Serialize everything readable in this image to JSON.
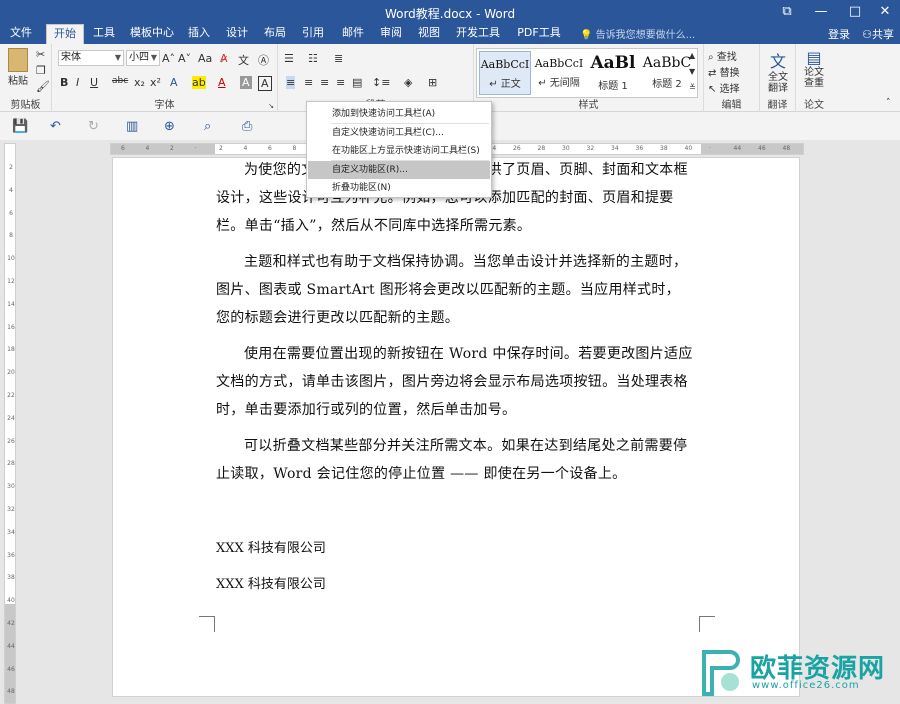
{
  "window": {
    "title": "Word教程.docx - Word",
    "restore_icon": "restore-icon",
    "minimize_label": "—",
    "maximize_label": "□",
    "close_label": "✕"
  },
  "tabs": [
    "文件",
    "开始",
    "工具",
    "模板中心",
    "插入",
    "设计",
    "布局",
    "引用",
    "邮件",
    "审阅",
    "视图",
    "开发工具",
    "PDF工具集"
  ],
  "active_tab": "开始",
  "tell_me": "告诉我您想要做什么...",
  "login": "登录",
  "share": "共享",
  "ribbon": {
    "clipboard": {
      "paste": "粘贴",
      "label": "剪贴板"
    },
    "font": {
      "name": "宋体",
      "size": "小四",
      "label": "字体"
    },
    "paragraph": {
      "label": "段落"
    },
    "styles": {
      "label": "样式",
      "items": [
        {
          "sample": "AaBbCcI",
          "name": "↵ 正文"
        },
        {
          "sample": "AaBbCcI",
          "name": "↵ 无间隔"
        },
        {
          "sample": "AaBl",
          "name": "标题 1"
        },
        {
          "sample": "AaBbC",
          "name": "标题 2"
        }
      ]
    },
    "editing": {
      "find": "查找",
      "replace": "替换",
      "select": "选择",
      "label": "编辑"
    },
    "translate": {
      "text": "全文翻译",
      "label": "翻译"
    },
    "paper": {
      "text": "论文查重",
      "label": "论文"
    }
  },
  "context_menu": {
    "items": [
      "添加到快速访问工具栏(A)",
      "自定义快速访问工具栏(C)...",
      "在功能区上方显示快速访问工具栏(S)",
      "自定义功能区(R)...",
      "折叠功能区(N)"
    ],
    "highlighted_index": 3
  },
  "document": {
    "paragraphs": [
      "为使您的文档具有专业外观，Word 提供了页眉、页脚、封面和文本框设计，这些设计可互为补充。例如，您可以添加匹配的封面、页眉和提要栏。单击“插入”，然后从不同库中选择所需元素。",
      "主题和样式也有助于文档保持协调。当您单击设计并选择新的主题时，图片、图表或 SmartArt 图形将会更改以匹配新的主题。当应用样式时，您的标题会进行更改以匹配新的主题。",
      "使用在需要位置出现的新按钮在 Word 中保存时间。若要更改图片适应文档的方式，请单击该图片，图片旁边将会显示布局选项按钮。当处理表格时，单击要添加行或列的位置，然后单击加号。",
      "可以折叠文档某些部分并关注所需文本。如果在达到结尾处之前需要停止读取，Word 会记住您的停止位置 —— 即使在另一个设备上。"
    ],
    "signature_lines": [
      "XXX 科技有限公司",
      "XXX 科技有限公司"
    ]
  },
  "ruler": {
    "h_ticks": [
      "6",
      "4",
      "2",
      "",
      "2",
      "4",
      "6",
      "8",
      "10",
      "12",
      "14",
      "16",
      "18",
      "20",
      "22",
      "24",
      "26",
      "28",
      "30",
      "32",
      "34",
      "36",
      "38",
      "40",
      "",
      "44",
      "46",
      "48"
    ],
    "v_ticks": [
      "2",
      "4",
      "6",
      "8",
      "10",
      "12",
      "14",
      "16",
      "18",
      "20",
      "22",
      "24",
      "26",
      "28",
      "30",
      "32",
      "34",
      "36",
      "38",
      "40",
      "42",
      "44",
      "46",
      "48"
    ]
  },
  "watermark": {
    "text": "欧菲资源网",
    "url": "www.office26.com"
  },
  "colors": {
    "brand": "#2b579a",
    "watermark": "#1aa3a3"
  }
}
